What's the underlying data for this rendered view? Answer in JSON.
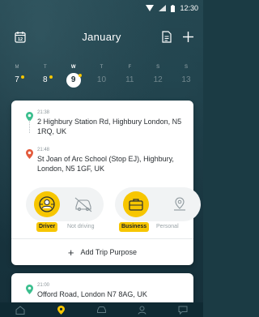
{
  "status_bar": {
    "time": "12:30"
  },
  "header": {
    "month": "January"
  },
  "week": {
    "days": [
      {
        "letter": "M",
        "num": "7",
        "has_trip": true,
        "selected": false,
        "active": false
      },
      {
        "letter": "T",
        "num": "8",
        "has_trip": true,
        "selected": false,
        "active": false
      },
      {
        "letter": "W",
        "num": "9",
        "has_trip": true,
        "selected": true,
        "active": true
      },
      {
        "letter": "T",
        "num": "10",
        "has_trip": false,
        "selected": false,
        "active": false
      },
      {
        "letter": "F",
        "num": "11",
        "has_trip": false,
        "selected": false,
        "active": false
      },
      {
        "letter": "S",
        "num": "12",
        "has_trip": false,
        "selected": false,
        "active": false
      },
      {
        "letter": "S",
        "num": "13",
        "has_trip": false,
        "selected": false,
        "active": false
      }
    ]
  },
  "trip1": {
    "start": {
      "time": "21:38",
      "address": "2 Highbury Station Rd, Highbury London, N5 1RQ, UK"
    },
    "end": {
      "time": "21:48",
      "address": "St Joan of Arc School (Stop EJ), Highbury, London, N5 1GF, UK"
    },
    "role": {
      "driver_label": "Driver",
      "not_driving_label": "Not driving",
      "selected": "Driver"
    },
    "purpose": {
      "business_label": "Business",
      "personal_label": "Personal",
      "selected": "Business"
    },
    "add_purpose_label": "Add Trip Purpose"
  },
  "trip2": {
    "start": {
      "time": "21:00",
      "address": "Offord Road, London N7 8AG, UK"
    }
  },
  "colors": {
    "accent": "#f7c600",
    "start_pin": "#3bbf8e",
    "end_pin": "#e35a3c",
    "background": "#1b3b44"
  },
  "bottom_nav": {
    "items": [
      {
        "icon": "home-icon",
        "active": false
      },
      {
        "icon": "location-pin-icon",
        "active": true
      },
      {
        "icon": "car-icon",
        "active": false
      },
      {
        "icon": "person-icon",
        "active": false
      },
      {
        "icon": "chat-icon",
        "active": false
      }
    ]
  }
}
